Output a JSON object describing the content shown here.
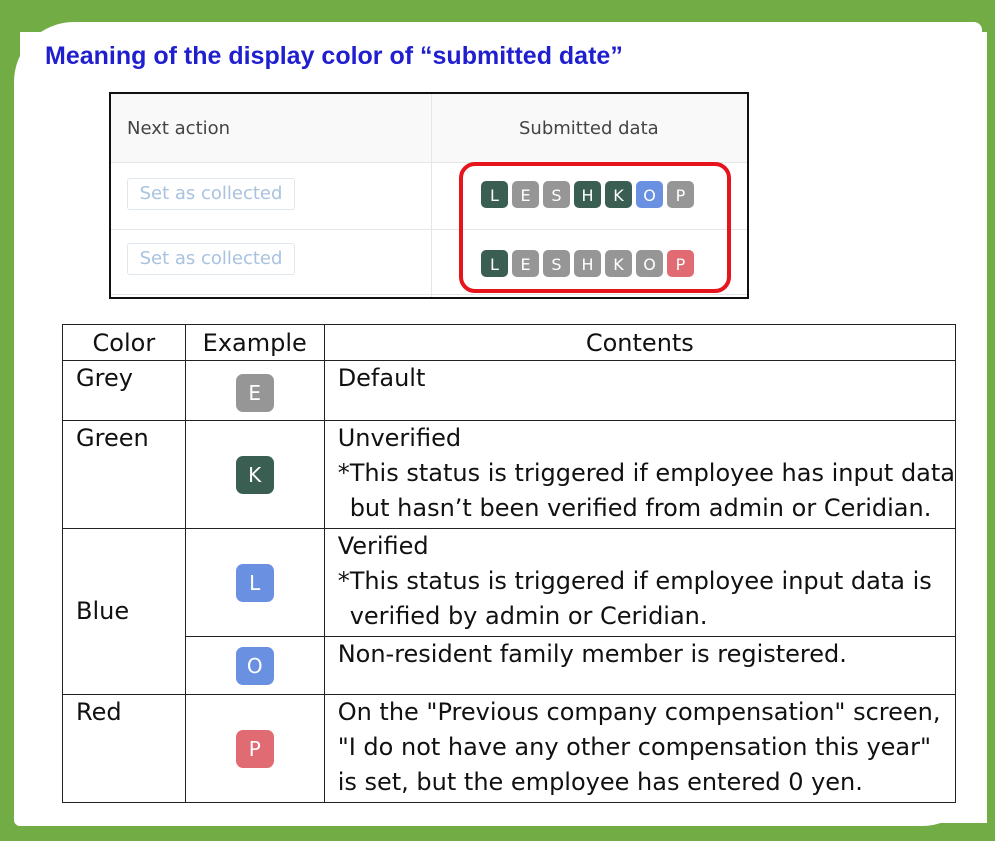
{
  "title": "Meaning of the display color of “submitted date”",
  "colors": {
    "grey": "#969696",
    "green": "#3a5f52",
    "blue": "#6a90e2",
    "red": "#e06b72",
    "frame": "#72ac44",
    "title": "#1f1fcf",
    "highlight": "#e6141c"
  },
  "screenshot": {
    "col_next_action": "Next action",
    "col_submitted": "Submitted data",
    "rows": [
      {
        "button": "Set as collected",
        "chips": [
          {
            "letter": "L",
            "color": "green"
          },
          {
            "letter": "E",
            "color": "grey"
          },
          {
            "letter": "S",
            "color": "grey"
          },
          {
            "letter": "H",
            "color": "green"
          },
          {
            "letter": "K",
            "color": "green"
          },
          {
            "letter": "O",
            "color": "blue"
          },
          {
            "letter": "P",
            "color": "grey"
          }
        ]
      },
      {
        "button": "Set as collected",
        "chips": [
          {
            "letter": "L",
            "color": "green"
          },
          {
            "letter": "E",
            "color": "grey"
          },
          {
            "letter": "S",
            "color": "grey"
          },
          {
            "letter": "H",
            "color": "grey"
          },
          {
            "letter": "K",
            "color": "grey"
          },
          {
            "letter": "O",
            "color": "grey"
          },
          {
            "letter": "P",
            "color": "red"
          }
        ]
      }
    ]
  },
  "legend": {
    "headers": {
      "color": "Color",
      "example": "Example",
      "contents": "Contents"
    },
    "grey": {
      "name": "Grey",
      "chip": "E",
      "line1": "Default"
    },
    "green": {
      "name": "Green",
      "chip": "K",
      "line1": "Unverified",
      "line2": "*This status is triggered if employee has input data",
      "line3": "but hasn’t been verified from admin or Ceridian."
    },
    "blue": {
      "name": "Blue",
      "chip1": "L",
      "line1": "Verified",
      "line2": "*This status is triggered if employee input data is",
      "line3": "verified by admin or Ceridian.",
      "chip2": "O",
      "line4": "Non-resident family member is registered."
    },
    "red": {
      "name": "Red",
      "chip": "P",
      "line1": "On the \"Previous company compensation\" screen,",
      "line2": "\"I do not have any other compensation this year\"",
      "line3": "is set, but the employee has entered 0 yen."
    }
  }
}
